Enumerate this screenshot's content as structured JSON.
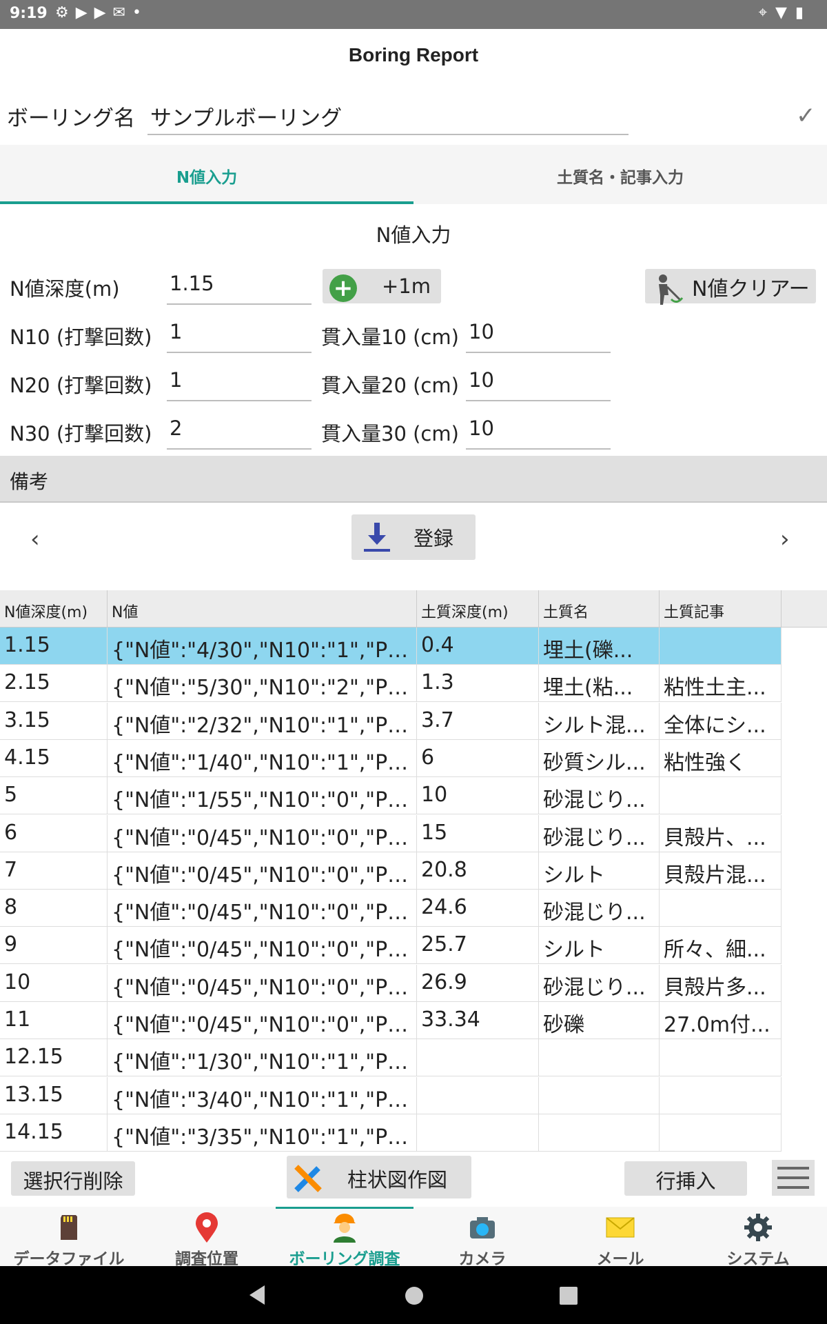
{
  "status_bar": {
    "time": "9:19"
  },
  "app": {
    "title": "Boring Report"
  },
  "boring": {
    "label": "ボーリング名",
    "value": "サンプルボーリング"
  },
  "tabs": [
    {
      "label": "N値入力",
      "active": true
    },
    {
      "label": "土質名・記事入力",
      "active": false
    }
  ],
  "form": {
    "section_title": "N値入力",
    "depth_label": "N値深度(m)",
    "depth_value": "1.15",
    "plus_button": "+1m",
    "clear_button": "N値クリアー",
    "n10_label": "N10 (打撃回数)",
    "n10_value": "1",
    "n20_label": "N20 (打撃回数)",
    "n20_value": "1",
    "n30_label": "N30 (打撃回数)",
    "n30_value": "2",
    "pen10_label": "貫入量10 (cm)",
    "pen10_value": "10",
    "pen20_label": "貫入量20 (cm)",
    "pen20_value": "10",
    "pen30_label": "貫入量30 (cm)",
    "pen30_value": "10",
    "remarks_label": "備考",
    "register_button": "登録"
  },
  "table": {
    "headers": [
      "N値深度(m)",
      "N値",
      "土質深度(m)",
      "土質名",
      "土質記事"
    ],
    "rows": [
      [
        "1.15",
        "{\"N値\":\"4/30\",\"N10\":\"1\",\"P1...",
        "0.4",
        "埋土(礫...",
        ""
      ],
      [
        "2.15",
        "{\"N値\":\"5/30\",\"N10\":\"2\",\"P1...",
        "1.3",
        "埋土(粘...",
        "粘性土主..."
      ],
      [
        "3.15",
        "{\"N値\":\"2/32\",\"N10\":\"1\",\"P1...",
        "3.7",
        "シルト混...",
        "全体にシ..."
      ],
      [
        "4.15",
        "{\"N値\":\"1/40\",\"N10\":\"1\",\"P1...",
        "6",
        "砂質シル...",
        "粘性強く"
      ],
      [
        "5",
        "{\"N値\":\"1/55\",\"N10\":\"0\",\"P1...",
        "10",
        "砂混じり...",
        ""
      ],
      [
        "6",
        "{\"N値\":\"0/45\",\"N10\":\"0\",\"P1...",
        "15",
        "砂混じり...",
        "貝殻片、..."
      ],
      [
        "7",
        "{\"N値\":\"0/45\",\"N10\":\"0\",\"P1...",
        "20.8",
        "シルト",
        "貝殻片混..."
      ],
      [
        "8",
        "{\"N値\":\"0/45\",\"N10\":\"0\",\"P1...",
        "24.6",
        "砂混じり...",
        ""
      ],
      [
        "9",
        "{\"N値\":\"0/45\",\"N10\":\"0\",\"P1...",
        "25.7",
        "シルト",
        "所々、細..."
      ],
      [
        "10",
        "{\"N値\":\"0/45\",\"N10\":\"0\",\"P1...",
        "26.9",
        "砂混じり...",
        "貝殻片多..."
      ],
      [
        "11",
        "{\"N値\":\"0/45\",\"N10\":\"0\",\"P1...",
        "33.34",
        "砂礫",
        "27.0m付..."
      ],
      [
        "12.15",
        "{\"N値\":\"1/30\",\"N10\":\"1\",\"P1...",
        "",
        "",
        ""
      ],
      [
        "13.15",
        "{\"N値\":\"3/40\",\"N10\":\"1\",\"P1...",
        "",
        "",
        ""
      ],
      [
        "14.15",
        "{\"N値\":\"3/35\",\"N10\":\"1\",\"P1...",
        "",
        "",
        ""
      ]
    ],
    "selected_row": 0
  },
  "actions": {
    "delete_row": "選択行削除",
    "draw_column": "柱状図作図",
    "insert_row": "行挿入"
  },
  "nav": [
    {
      "label": "データファイル",
      "icon": "sd-card-icon"
    },
    {
      "label": "調査位置",
      "icon": "location-pin-icon"
    },
    {
      "label": "ボーリング調査",
      "icon": "worker-icon",
      "active": true
    },
    {
      "label": "カメラ",
      "icon": "camera-icon"
    },
    {
      "label": "メール",
      "icon": "mail-icon"
    },
    {
      "label": "システム",
      "icon": "gear-icon"
    }
  ],
  "colors": {
    "accent": "#1a9e8f",
    "selected_row": "#8ed6ef",
    "status_bar": "#757575"
  }
}
